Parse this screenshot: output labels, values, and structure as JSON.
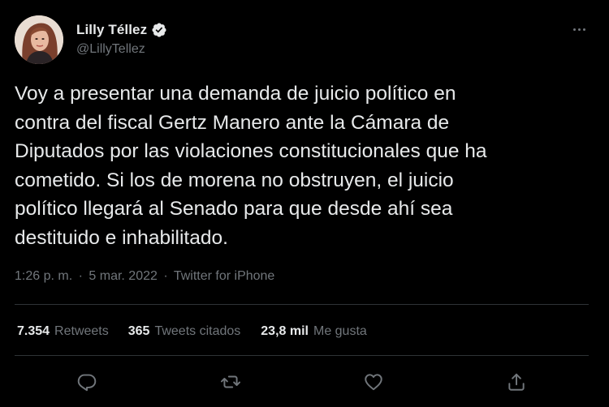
{
  "author": {
    "name": "Lilly Téllez",
    "handle": "@LillyTellez",
    "verified_icon": "verified-badge-icon"
  },
  "tweet": {
    "text": "Voy a presentar una demanda de juicio político en\ncontra del fiscal Gertz Manero ante la Cámara de\nDiputados por las violaciones constitucionales que ha\ncometido. Si los de morena no obstruyen, el juicio\npolítico llegará al Senado para que desde ahí sea\ndestituido e inhabilitado.",
    "time": "1:26 p. m.",
    "separator": "·",
    "date": "5 mar. 2022",
    "source": "Twitter for iPhone"
  },
  "stats": {
    "retweets": {
      "count": "7.354",
      "label": "Retweets"
    },
    "quotes": {
      "count": "365",
      "label": "Tweets citados"
    },
    "likes": {
      "count": "23,8 mil",
      "label": "Me gusta"
    }
  },
  "actions": [
    "reply-icon",
    "retweet-icon",
    "like-icon",
    "share-icon"
  ],
  "colors": {
    "background": "#000000",
    "text_primary": "#e7e9ea",
    "text_secondary": "#71767b",
    "divider": "#2f3336",
    "verified": "#e7e9ea"
  }
}
